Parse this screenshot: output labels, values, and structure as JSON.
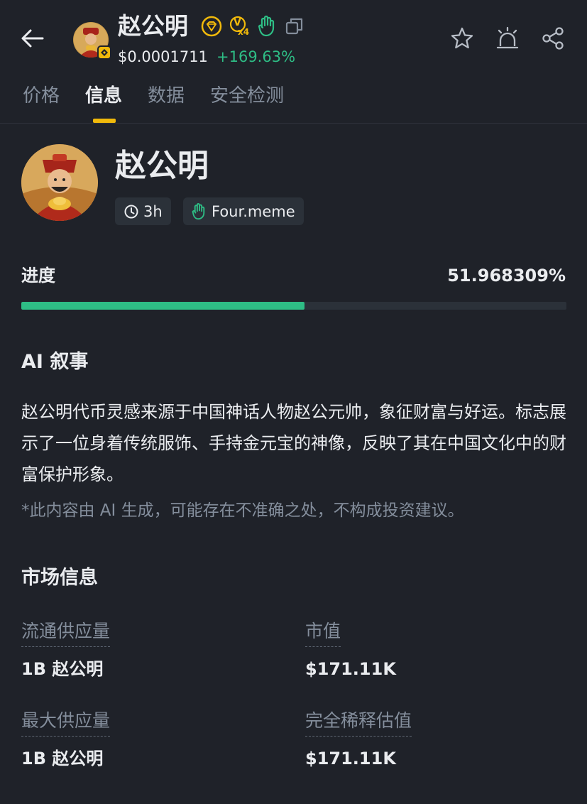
{
  "header": {
    "title": "赵公明",
    "price": "$0.0001711",
    "change": "+169.63%",
    "badge_multiplier": "x4",
    "badge_letter": "V"
  },
  "tabs": [
    {
      "label": "价格",
      "active": false
    },
    {
      "label": "信息",
      "active": true
    },
    {
      "label": "数据",
      "active": false
    },
    {
      "label": "安全检测",
      "active": false
    }
  ],
  "token": {
    "name": "赵公明",
    "age": "3h",
    "platform": "Four.meme"
  },
  "progress": {
    "label": "进度",
    "value_text": "51.968309%",
    "fraction": 0.51968309
  },
  "ai": {
    "title": "AI 叙事",
    "body": "赵公明代币灵感来源于中国神话人物赵公元帅，象征财富与好运。标志展示了一位身着传统服饰、手持金元宝的神像，反映了其在中国文化中的财富保护形象。",
    "disclaimer": "*此内容由 AI 生成，可能存在不准确之处，不构成投资建议。"
  },
  "market": {
    "title": "市场信息",
    "circulating_label": "流通供应量",
    "circulating_value": "1B 赵公明",
    "market_cap_label": "市值",
    "market_cap_value": "$171.11K",
    "max_supply_label": "最大供应量",
    "max_supply_value": "1B 赵公明",
    "fdv_label": "完全稀释估值",
    "fdv_value": "$171.11K"
  },
  "colors": {
    "background": "#1f2229",
    "positive": "#2ebd85",
    "accent": "#f0b90b",
    "muted_text": "#848e9c"
  },
  "icons": [
    "back-arrow-icon",
    "diamond-badge-icon",
    "vip-badge-icon",
    "hand-icon",
    "copy-icon",
    "star-icon",
    "alert-icon",
    "share-icon",
    "clock-icon",
    "bnb-chain-icon"
  ]
}
